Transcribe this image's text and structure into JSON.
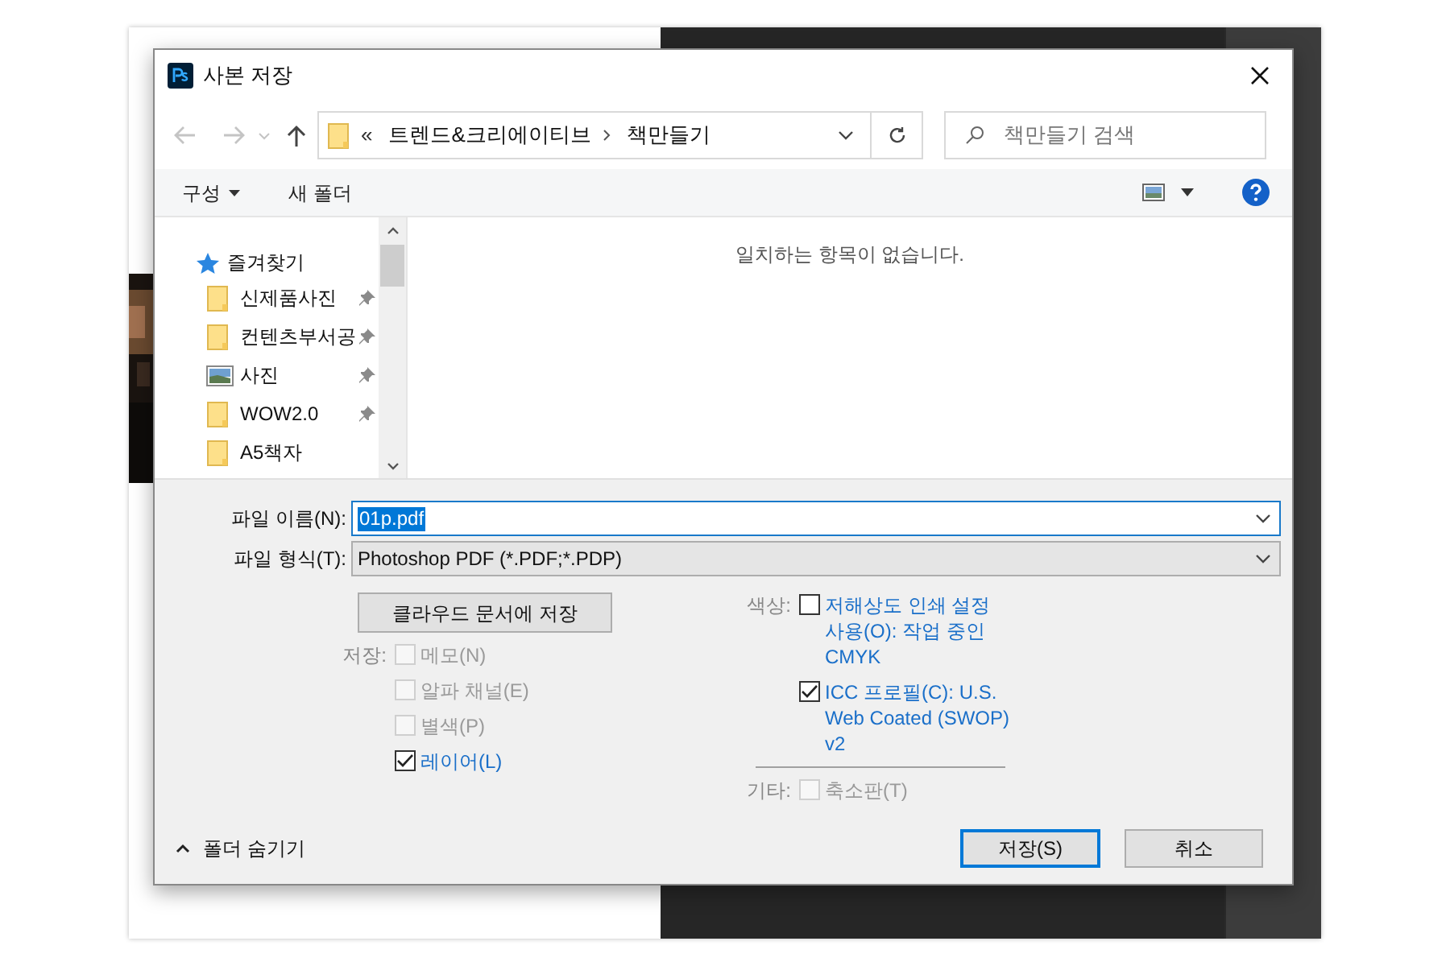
{
  "dialog": {
    "title": "사본 저장"
  },
  "address": {
    "overflow": "«",
    "path": [
      "트렌드&크리에이티브",
      "책만들기"
    ]
  },
  "search": {
    "placeholder": "책만들기 검색"
  },
  "toolbar": {
    "organize": "구성",
    "new_folder": "새 폴더"
  },
  "sidebar": {
    "header": "즐겨찾기",
    "items": [
      {
        "label": "신제품사진",
        "kind": "folder",
        "pinned": true
      },
      {
        "label": "컨텐츠부서공",
        "kind": "folder",
        "pinned": true
      },
      {
        "label": "사진",
        "kind": "pictures",
        "pinned": true
      },
      {
        "label": "WOW2.0",
        "kind": "folder",
        "pinned": true
      },
      {
        "label": "A5책자",
        "kind": "folder",
        "pinned": false
      }
    ]
  },
  "content": {
    "empty_message": "일치하는 항목이 없습니다."
  },
  "file_name": {
    "label": "파일 이름(N):",
    "value": "01p.pdf"
  },
  "file_type": {
    "label": "파일 형식(T):",
    "value": "Photoshop PDF (*.PDF;*.PDP)"
  },
  "cloud_button": "클라우드 문서에 저장",
  "save_options": {
    "label": "저장:",
    "options": [
      {
        "label": "메모(N)",
        "checked": false,
        "disabled": true
      },
      {
        "label": "알파 채널(E)",
        "checked": false,
        "disabled": true
      },
      {
        "label": "별색(P)",
        "checked": false,
        "disabled": true
      },
      {
        "label": "레이어(L)",
        "checked": true,
        "disabled": false
      }
    ]
  },
  "color_options": {
    "label": "색상:",
    "options": [
      {
        "label": "저해상도 인쇄 설정 사용(O):  작업 중인 CMYK",
        "checked": false,
        "disabled": false
      },
      {
        "label": "ICC 프로필(C):  U.S. Web Coated (SWOP) v2",
        "checked": true,
        "disabled": false
      }
    ]
  },
  "other_options": {
    "label": "기타:",
    "options": [
      {
        "label": "축소판(T)",
        "checked": false,
        "disabled": true
      }
    ]
  },
  "hide_folders": "폴더 숨기기",
  "buttons": {
    "save": "저장(S)",
    "cancel": "취소"
  }
}
